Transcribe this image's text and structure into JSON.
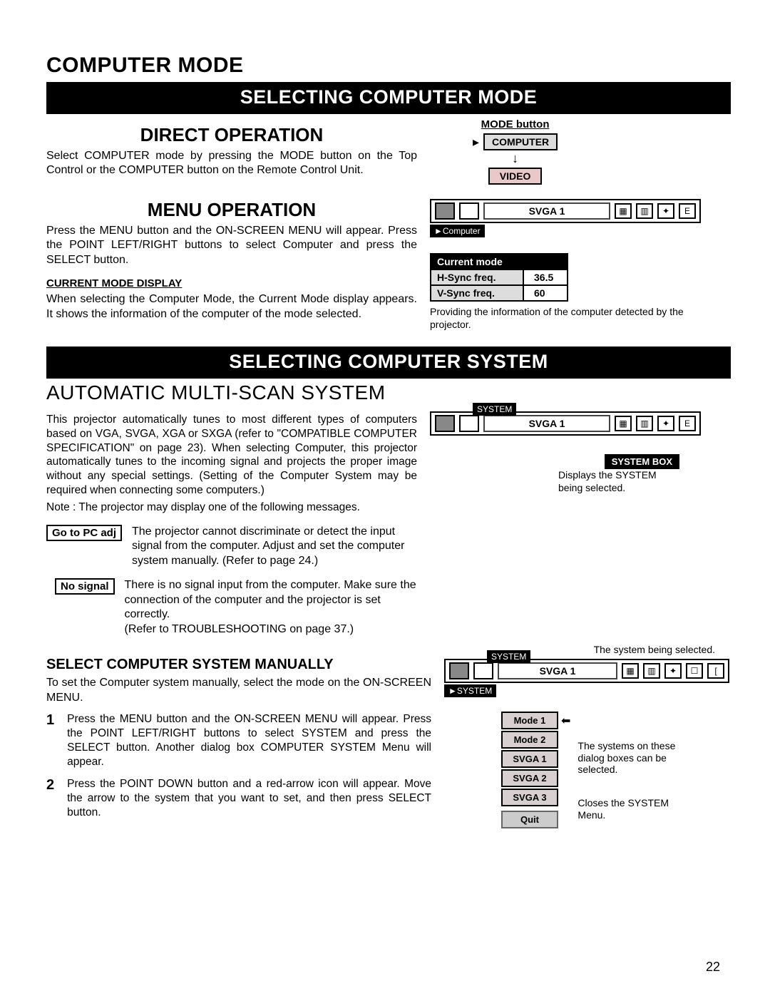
{
  "page_title": "COMPUTER MODE",
  "bar1": "SELECTING COMPUTER MODE",
  "direct": {
    "title": "DIRECT OPERATION",
    "body": "Select COMPUTER mode by pressing the MODE button on the Top Control or the COMPUTER button on the Remote Control Unit."
  },
  "mode_button": {
    "title": "MODE button",
    "computer": "COMPUTER",
    "video": "VIDEO"
  },
  "menu": {
    "title": "MENU OPERATION",
    "body": "Press the MENU button and the ON-SCREEN MENU will appear. Press the POINT LEFT/RIGHT buttons to select Computer and press the SELECT button.",
    "subhead": "CURRENT MODE DISPLAY",
    "body2": "When selecting the Computer Mode, the Current Mode display appears. It shows the information of the computer of the mode selected."
  },
  "mock1": {
    "svga": "SVGA 1",
    "computer_tag": "►Computer"
  },
  "cm": {
    "header": "Current mode",
    "h_label": "H-Sync freq.",
    "h_val": "36.5",
    "v_label": "V-Sync freq.",
    "v_val": "60",
    "note": "Providing the information of the computer detected by the projector."
  },
  "bar2": "SELECTING COMPUTER SYSTEM",
  "auto_title": "AUTOMATIC MULTI-SCAN SYSTEM",
  "auto_body": "This projector automatically tunes to most different types of computers based on VGA, SVGA, XGA or SXGA (refer to \"COMPATIBLE COMPUTER SPECIFICATION\" on page 23). When selecting Computer, this projector automatically tunes to the incoming signal and projects the proper image without any special settings. (Setting of the Computer System may be required when connecting some computers.)",
  "auto_note": "Note : The projector may display one of the following messages.",
  "msg1": {
    "label": "Go to PC adj",
    "text": "The projector cannot discriminate or detect the input signal from the computer. Adjust and set the computer system manually. (Refer to page 24.)"
  },
  "msg2": {
    "label": "No signal",
    "text": "There is no signal input from the computer. Make sure the connection of the computer and the projector is set correctly.\n(Refer to TROUBLESHOOTING on page 37.)"
  },
  "sysbox": {
    "system_tag": "SYSTEM",
    "svga": "SVGA 1",
    "label": "SYSTEM BOX",
    "note": "Displays the SYSTEM being selected."
  },
  "manual_title": "SELECT COMPUTER SYSTEM MANUALLY",
  "manual_body": "To set the Computer system manually, select the mode on the ON-SCREEN MENU.",
  "step1": "Press the MENU button and the ON-SCREEN MENU will appear. Press the POINT LEFT/RIGHT buttons to select SYSTEM and press the SELECT button. Another dialog box COMPUTER SYSTEM Menu will appear.",
  "step2": "Press the POINT DOWN button and a red-arrow icon will appear. Move the arrow to the system that you want to set, and then press SELECT button.",
  "modes_mock": {
    "top_note": "The system being selected.",
    "svga": "SVGA 1",
    "system_tag": "►SYSTEM",
    "items": [
      "Mode 1",
      "Mode 2",
      "SVGA 1",
      "SVGA 2",
      "SVGA 3"
    ],
    "quit": "Quit",
    "callout1": "The systems on these dialog boxes can be selected.",
    "callout2": "Closes the SYSTEM Menu."
  },
  "page_number": "22"
}
